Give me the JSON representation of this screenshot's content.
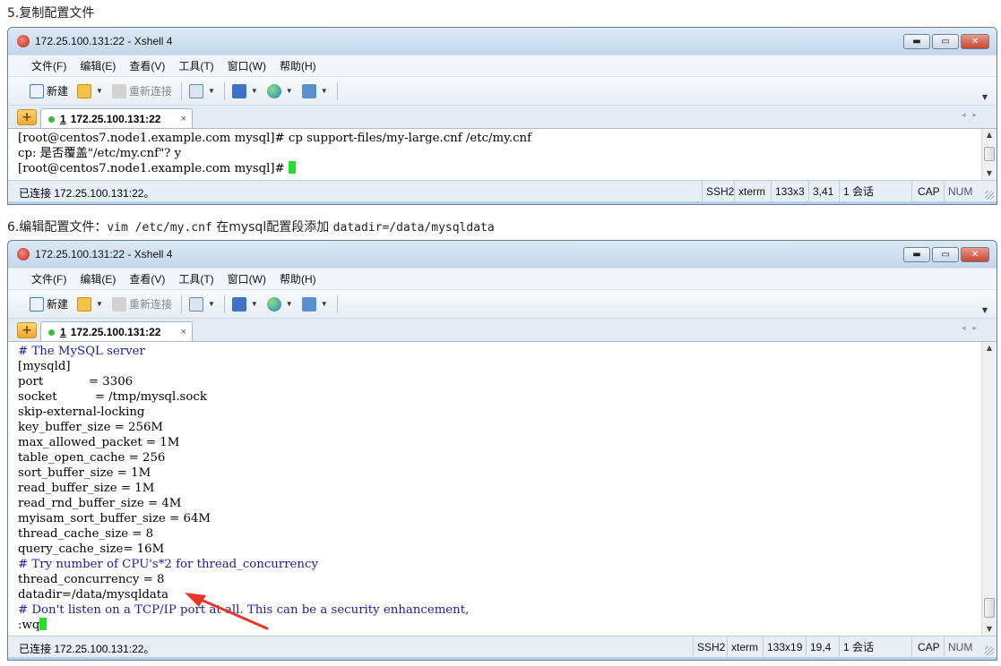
{
  "step5": {
    "number": "5.",
    "text": "复制配置文件"
  },
  "step6": {
    "number": "6.",
    "text": "编辑配置文件：",
    "command": "vim /etc/my.cnf",
    "middle": "在mysql配置段添加",
    "setting": "datadir=/data/mysqldata"
  },
  "window": {
    "title": "172.25.100.131:22 - Xshell 4",
    "controls": {
      "minimize": "▬",
      "restore": "▭",
      "close": "✕"
    },
    "menu": [
      "文件(F)",
      "编辑(E)",
      "查看(V)",
      "工具(T)",
      "窗口(W)",
      "帮助(H)"
    ],
    "toolbar": {
      "new": "新建",
      "reconnect": "重新连接"
    },
    "tab": {
      "index": "1",
      "label": "172.25.100.131:22",
      "close": "×"
    },
    "tab_add": "+",
    "tab_nav": "◂▸"
  },
  "window1": {
    "terminal": [
      {
        "text": "[root@centos7.node1.example.com mysql]# cp support-files/my-large.cnf /etc/my.cnf",
        "style": "normal"
      },
      {
        "text": "cp: 是否覆盖\"/etc/my.cnf\"? y",
        "style": "normal"
      },
      {
        "text": "[root@centos7.node1.example.com mysql]# ",
        "style": "normal",
        "cursor": true
      }
    ],
    "status": {
      "connection": "已连接 172.25.100.131:22。",
      "protocol": "SSH2",
      "term": "xterm",
      "size": "133x3",
      "pos": "3,41",
      "sessions": "1 会话",
      "cap": "CAP",
      "num": "NUM"
    }
  },
  "window2": {
    "terminal": [
      {
        "text": "# The MySQL server",
        "style": "comment"
      },
      {
        "text": "[mysqld]",
        "style": "normal"
      },
      {
        "text": "port            = 3306",
        "style": "normal"
      },
      {
        "text": "socket          = /tmp/mysql.sock",
        "style": "normal"
      },
      {
        "text": "skip-external-locking",
        "style": "normal"
      },
      {
        "text": "key_buffer_size = 256M",
        "style": "normal"
      },
      {
        "text": "max_allowed_packet = 1M",
        "style": "normal"
      },
      {
        "text": "table_open_cache = 256",
        "style": "normal"
      },
      {
        "text": "sort_buffer_size = 1M",
        "style": "normal"
      },
      {
        "text": "read_buffer_size = 1M",
        "style": "normal"
      },
      {
        "text": "read_rnd_buffer_size = 4M",
        "style": "normal"
      },
      {
        "text": "myisam_sort_buffer_size = 64M",
        "style": "normal"
      },
      {
        "text": "thread_cache_size = 8",
        "style": "normal"
      },
      {
        "text": "query_cache_size= 16M",
        "style": "normal"
      },
      {
        "text": "# Try number of CPU's*2 for thread_concurrency",
        "style": "comment"
      },
      {
        "text": "thread_concurrency = 8",
        "style": "normal"
      },
      {
        "text": "datadir=/data/mysqldata",
        "style": "normal"
      },
      {
        "text": "# Don't listen on a TCP/IP port at all. This can be a security enhancement,",
        "style": "comment"
      },
      {
        "text": ":wq",
        "style": "normal",
        "cursor": true
      }
    ],
    "status": {
      "connection": "已连接 172.25.100.131:22。",
      "protocol": "SSH2",
      "term": "xterm",
      "size": "133x19",
      "pos": "19,4",
      "sessions": "1 会话",
      "cap": "CAP",
      "num": "NUM"
    }
  },
  "icons": {
    "app": "xshell-logo-icon",
    "new": "new-session-icon",
    "open": "folder-icon",
    "reconnect": "reconnect-icon",
    "properties": "properties-icon",
    "transfer": "transfer-icon",
    "globe": "globe-icon",
    "font": "font-icon",
    "annotation": "red-arrow-icon"
  },
  "colors": {
    "cursor": "#22e02a",
    "comment": "#1a1aa6",
    "arrow": "#e8372a",
    "connected_dot": "#2fbf3a"
  }
}
